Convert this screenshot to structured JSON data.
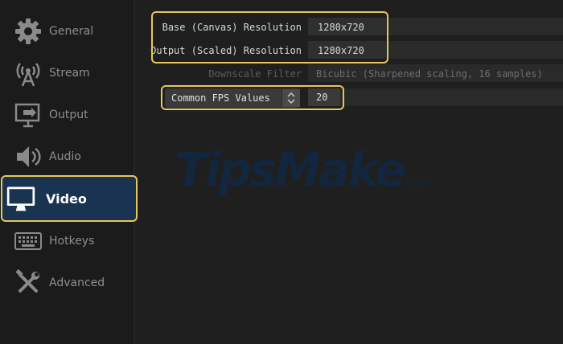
{
  "sidebar": {
    "items": [
      {
        "label": "General",
        "icon": "gear-icon",
        "active": false
      },
      {
        "label": "Stream",
        "icon": "antenna-icon",
        "active": false
      },
      {
        "label": "Output",
        "icon": "output-icon",
        "active": false
      },
      {
        "label": "Audio",
        "icon": "speaker-icon",
        "active": false
      },
      {
        "label": "Video",
        "icon": "monitor-icon",
        "active": true
      },
      {
        "label": "Hotkeys",
        "icon": "keyboard-icon",
        "active": false
      },
      {
        "label": "Advanced",
        "icon": "tools-icon",
        "active": false
      }
    ]
  },
  "video": {
    "base_resolution": {
      "label": "Base (Canvas) Resolution",
      "value": "1280x720"
    },
    "output_resolution": {
      "label": "Output (Scaled) Resolution",
      "value": "1280x720"
    },
    "downscale_filter": {
      "label": "Downscale Filter",
      "value": "Bicubic (Sharpened scaling, 16 samples)"
    },
    "fps": {
      "selector": "Common FPS Values",
      "value": "20"
    }
  },
  "watermark": {
    "text": "TipsMake",
    "suffix": ".com"
  },
  "colors": {
    "highlight": "#e6c75a",
    "active_bg": "#1a3350",
    "background": "#1f1f1f"
  }
}
